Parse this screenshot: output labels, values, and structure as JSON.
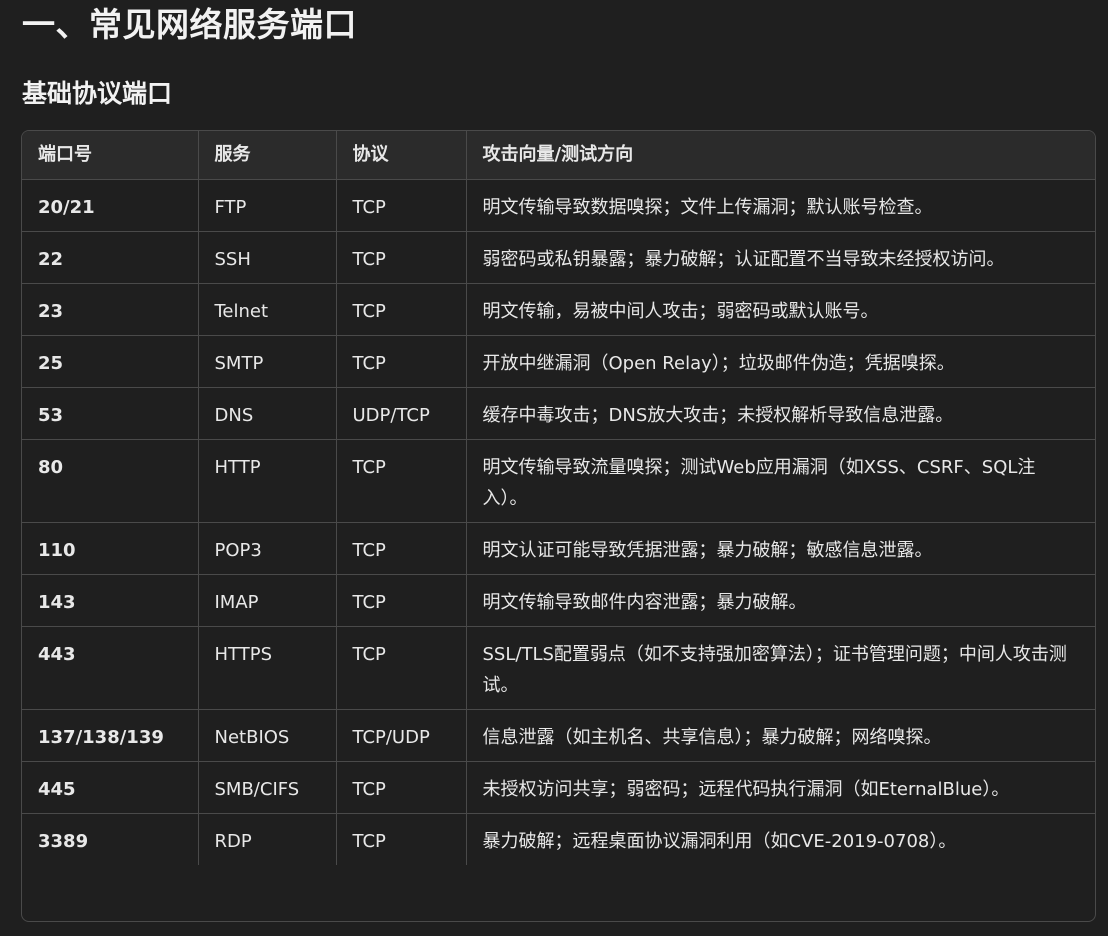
{
  "page_title": "一、常见网络服务端口",
  "section_title": "基础协议端口",
  "table": {
    "headers": [
      "端口号",
      "服务",
      "协议",
      "攻击向量/测试方向"
    ],
    "rows": [
      {
        "port": "20/21",
        "service": "FTP",
        "protocol": "TCP",
        "vector": "明文传输导致数据嗅探；文件上传漏洞；默认账号检查。"
      },
      {
        "port": "22",
        "service": "SSH",
        "protocol": "TCP",
        "vector": "弱密码或私钥暴露；暴力破解；认证配置不当导致未经授权访问。"
      },
      {
        "port": "23",
        "service": "Telnet",
        "protocol": "TCP",
        "vector": "明文传输，易被中间人攻击；弱密码或默认账号。"
      },
      {
        "port": "25",
        "service": "SMTP",
        "protocol": "TCP",
        "vector": "开放中继漏洞（Open Relay）；垃圾邮件伪造；凭据嗅探。"
      },
      {
        "port": "53",
        "service": "DNS",
        "protocol": "UDP/TCP",
        "vector": "缓存中毒攻击；DNS放大攻击；未授权解析导致信息泄露。"
      },
      {
        "port": "80",
        "service": "HTTP",
        "protocol": "TCP",
        "vector": "明文传输导致流量嗅探；测试Web应用漏洞（如XSS、CSRF、SQL注入）。"
      },
      {
        "port": "110",
        "service": "POP3",
        "protocol": "TCP",
        "vector": "明文认证可能导致凭据泄露；暴力破解；敏感信息泄露。"
      },
      {
        "port": "143",
        "service": "IMAP",
        "protocol": "TCP",
        "vector": "明文传输导致邮件内容泄露；暴力破解。"
      },
      {
        "port": "443",
        "service": "HTTPS",
        "protocol": "TCP",
        "vector": "SSL/TLS配置弱点（如不支持强加密算法）；证书管理问题；中间人攻击测试。"
      },
      {
        "port": "137/138/139",
        "service": "NetBIOS",
        "protocol": "TCP/UDP",
        "vector": "信息泄露（如主机名、共享信息）；暴力破解；网络嗅探。"
      },
      {
        "port": "445",
        "service": "SMB/CIFS",
        "protocol": "TCP",
        "vector": "未授权访问共享；弱密码；远程代码执行漏洞（如EternalBlue）。"
      },
      {
        "port": "3389",
        "service": "RDP",
        "protocol": "TCP",
        "vector": "暴力破解；远程桌面协议漏洞利用（如CVE-2019-0708）。"
      }
    ]
  }
}
